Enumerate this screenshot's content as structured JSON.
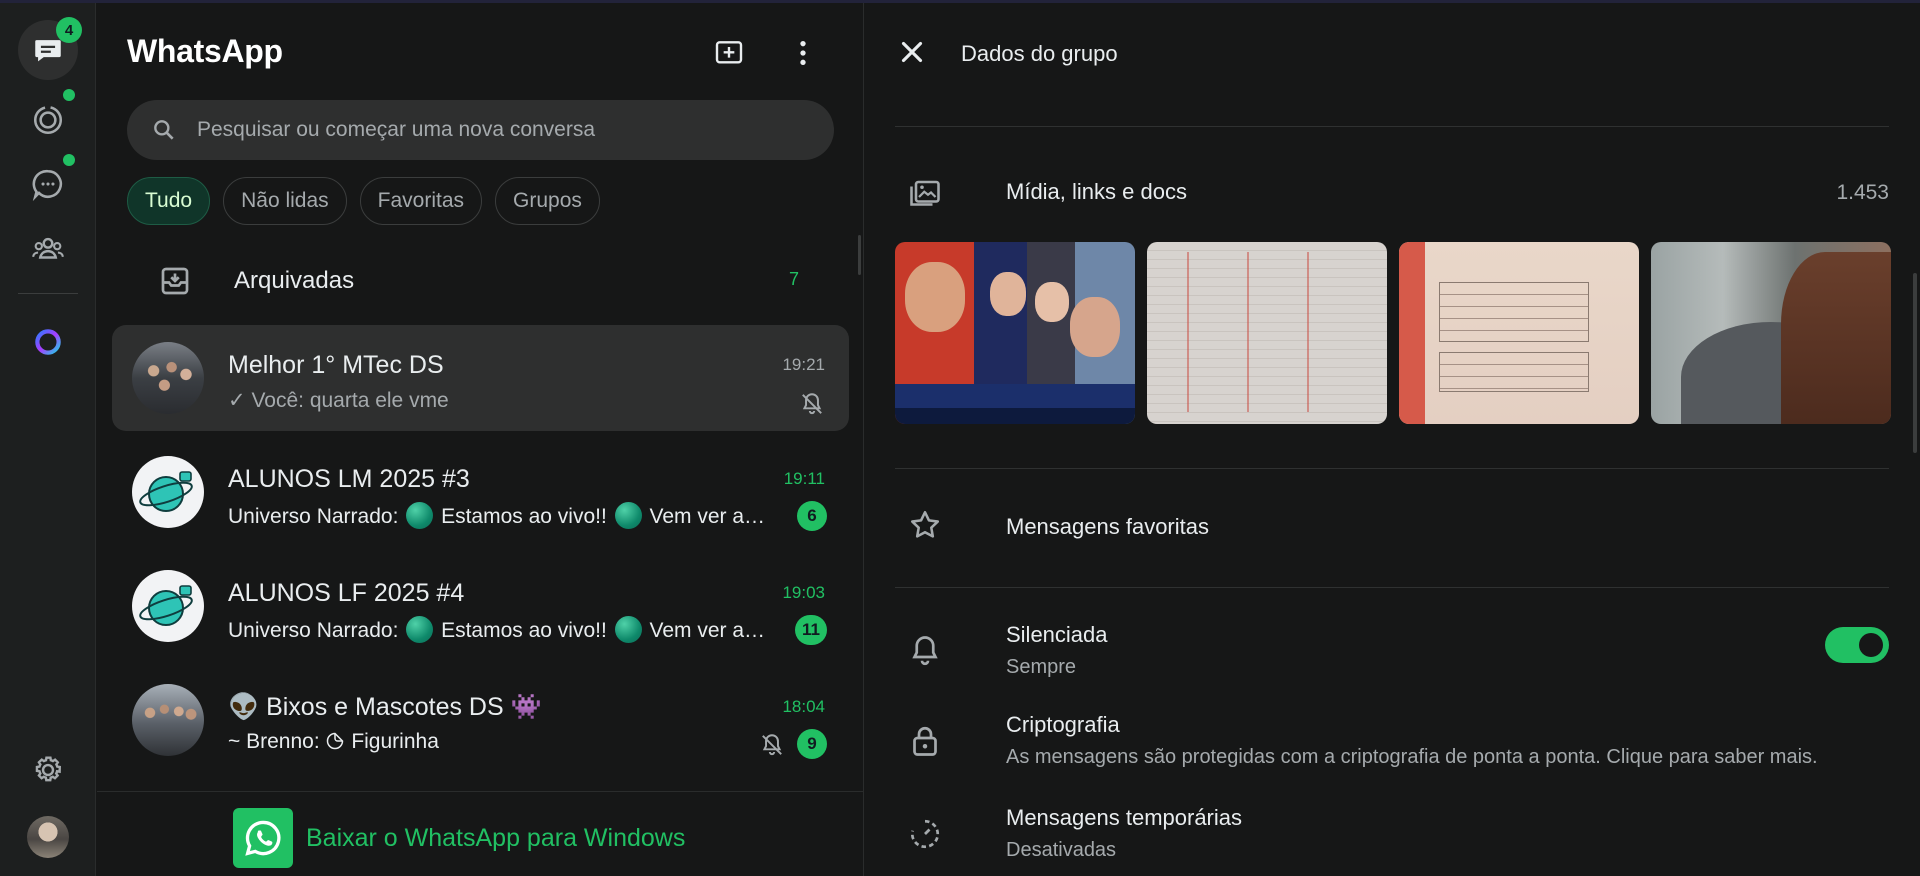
{
  "app": {
    "title": "WhatsApp"
  },
  "rail": {
    "chats_badge": "4",
    "items": [
      {
        "name": "chats",
        "icon": "chats-icon"
      },
      {
        "name": "status",
        "icon": "status-icon"
      },
      {
        "name": "channels",
        "icon": "channels-icon"
      },
      {
        "name": "communities",
        "icon": "communities-icon"
      },
      {
        "name": "meta-ai",
        "icon": "meta-ai-icon"
      },
      {
        "name": "settings",
        "icon": "gear-icon"
      },
      {
        "name": "profile",
        "icon": "avatar"
      }
    ]
  },
  "search": {
    "placeholder": "Pesquisar ou começar uma nova conversa"
  },
  "filters": [
    "Tudo",
    "Não lidas",
    "Favoritas",
    "Grupos"
  ],
  "archived": {
    "label": "Arquivadas",
    "count": "7"
  },
  "chats": [
    {
      "name": "Melhor 1° MTec DS",
      "time": "19:21",
      "check": "✓",
      "preview": "Você: quarta ele vme",
      "muted": true,
      "unread": ""
    },
    {
      "name": "ALUNOS LM 2025 #3",
      "time": "19:11",
      "preview_prefix": "Universo Narrado: ",
      "preview_mid": " Estamos ao vivo!! ",
      "preview_tail": " Vem ver a UNIVERSO NARRADO",
      "unread": "6"
    },
    {
      "name": "ALUNOS LF 2025 #4",
      "time": "19:03",
      "preview_prefix": "Universo Narrado: ",
      "preview_mid": " Estamos ao vivo!! ",
      "preview_tail": " Vem ver a UNIVERSO NARRADO",
      "unread": "11"
    },
    {
      "name": "👽 Bixos e Mascotes DS 👾",
      "time": "18:04",
      "preview_prefix": "~ Brenno: ",
      "preview_tail": " Figurinha",
      "muted": true,
      "unread": "9"
    }
  ],
  "download": {
    "label": "Baixar o WhatsApp para Windows"
  },
  "info": {
    "title": "Dados do grupo",
    "media": {
      "label": "Mídia, links e docs",
      "count": "1.453"
    },
    "starred": {
      "label": "Mensagens favoritas"
    },
    "muted": {
      "label": "Silenciada",
      "sub": "Sempre",
      "on": true
    },
    "encryption": {
      "label": "Criptografia",
      "sub": "As mensagens são protegidas com a criptografia de ponta a ponta. Clique para saber mais."
    },
    "disappearing": {
      "label": "Mensagens temporárias",
      "sub": "Desativadas"
    }
  },
  "colors": {
    "accent": "#21c063",
    "background": "#161717",
    "rail": "#1d1f1f",
    "selected": "#2e2f2f"
  }
}
